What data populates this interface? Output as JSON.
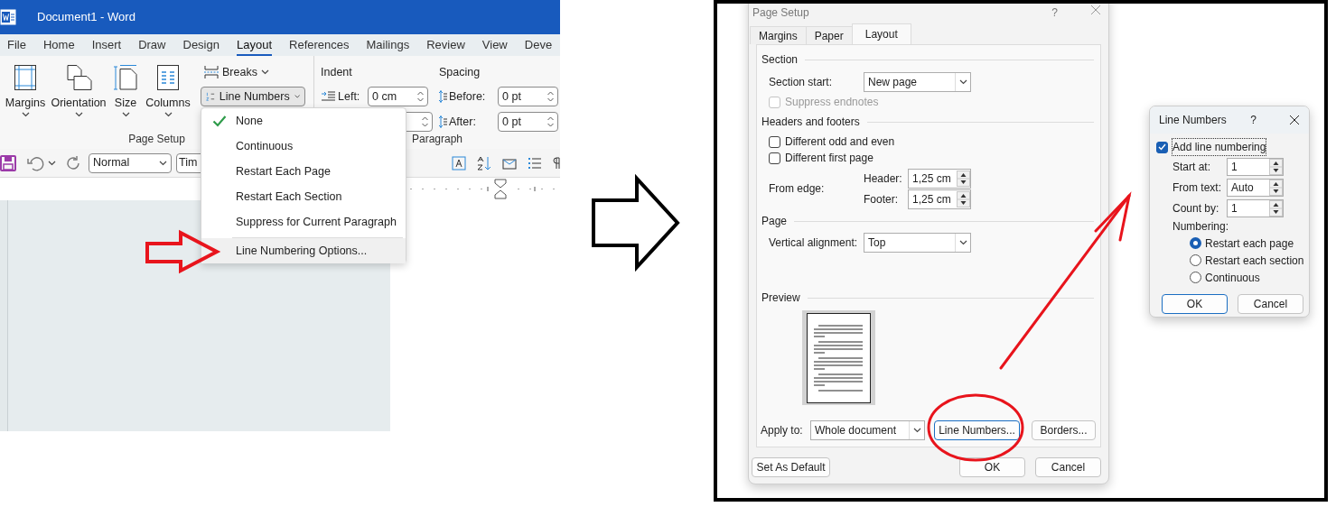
{
  "word_window": {
    "title": "Document1 - Word",
    "tabs": [
      {
        "label": "File",
        "selected": false
      },
      {
        "label": "Home",
        "selected": false
      },
      {
        "label": "Insert",
        "selected": false
      },
      {
        "label": "Draw",
        "selected": false
      },
      {
        "label": "Design",
        "selected": false
      },
      {
        "label": "Layout",
        "selected": true
      },
      {
        "label": "References",
        "selected": false
      },
      {
        "label": "Mailings",
        "selected": false
      },
      {
        "label": "Review",
        "selected": false
      },
      {
        "label": "View",
        "selected": false
      },
      {
        "label": "Deve",
        "selected": false
      }
    ],
    "ribbon": {
      "page_setup_buttons": [
        {
          "label": "Margins"
        },
        {
          "label": "Orientation"
        },
        {
          "label": "Size"
        },
        {
          "label": "Columns"
        }
      ],
      "breaks": "Breaks",
      "line_numbers": "Line Numbers",
      "indent_title": "Indent",
      "spacing_title": "Spacing",
      "left_label": "Left:",
      "left_value": "0 cm",
      "before_label": "Before:",
      "before_value": "0 pt",
      "after_label": "After:",
      "after_value": "0 pt",
      "group_labels": [
        "Page Setup",
        "Paragraph"
      ]
    },
    "quick_access": {
      "style_value": "Normal",
      "font_value": "Tim"
    },
    "line_numbers_menu": [
      {
        "label": "None",
        "checked": true,
        "highlighted": false
      },
      {
        "label": "Continuous",
        "checked": false,
        "highlighted": false
      },
      {
        "label": "Restart Each Page",
        "checked": false,
        "highlighted": false
      },
      {
        "label": "Restart Each Section",
        "checked": false,
        "highlighted": false
      },
      {
        "label": "Suppress for Current Paragraph",
        "checked": false,
        "highlighted": false
      },
      {
        "label": "Line Numbering Options...",
        "checked": false,
        "highlighted": true
      }
    ]
  },
  "page_setup_dialog": {
    "title": "Page Setup",
    "help_button": "?",
    "tabs": [
      {
        "label": "Margins",
        "selected": false
      },
      {
        "label": "Paper",
        "selected": false
      },
      {
        "label": "Layout",
        "selected": true
      }
    ],
    "section": {
      "heading": "Section",
      "section_start_label": "Section start:",
      "section_start_value": "New page",
      "suppress_endnotes": {
        "label": "Suppress endnotes",
        "checked": false,
        "disabled": true
      }
    },
    "headers_footers": {
      "heading": "Headers and footers",
      "checkboxes": [
        {
          "label": "Different odd and even",
          "checked": false,
          "disabled": false
        },
        {
          "label": "Different first page",
          "checked": false,
          "disabled": false
        }
      ],
      "from_edge_label": "From edge:",
      "header_label": "Header:",
      "header_value": "1,25 cm",
      "footer_label": "Footer:",
      "footer_value": "1,25 cm"
    },
    "page": {
      "heading": "Page",
      "vertical_alignment_label": "Vertical alignment:",
      "vertical_alignment_value": "Top"
    },
    "preview": {
      "heading": "Preview"
    },
    "apply_to_label": "Apply to:",
    "apply_to_value": "Whole document",
    "line_numbers_button": "Line Numbers...",
    "borders_button": "Borders...",
    "set_default_button": "Set As Default",
    "ok_button": "OK",
    "cancel_button": "Cancel"
  },
  "line_numbers_dialog": {
    "title": "Line Numbers",
    "help_button": "?",
    "add_line_numbering": {
      "label": "Add line numbering",
      "checked": true
    },
    "fields": [
      {
        "label": "Start at:",
        "value": "1"
      },
      {
        "label": "From text:",
        "value": "Auto"
      },
      {
        "label": "Count by:",
        "value": "1"
      }
    ],
    "numbering_label": "Numbering:",
    "options": [
      {
        "label": "Restart each page",
        "selected": true
      },
      {
        "label": "Restart each section",
        "selected": false
      },
      {
        "label": "Continuous",
        "selected": false
      }
    ],
    "ok_button": "OK",
    "cancel_button": "Cancel"
  }
}
